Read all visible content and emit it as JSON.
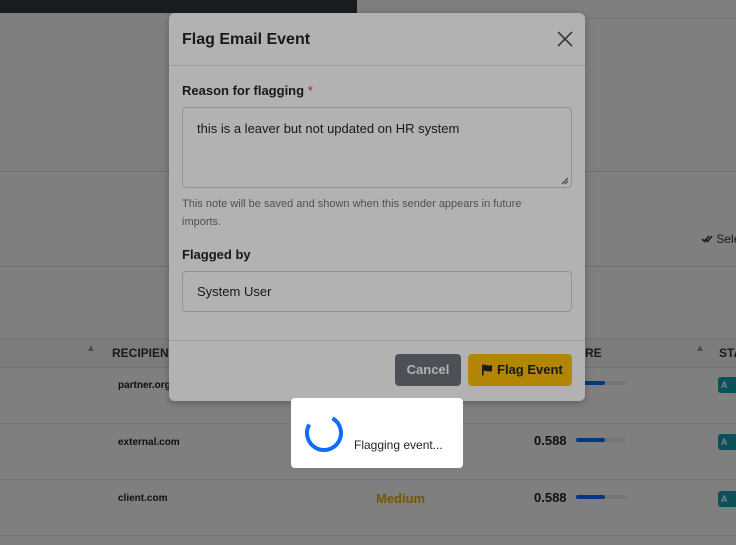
{
  "background": {
    "select_all_label": "Sele",
    "table": {
      "headers": {
        "recipient": "RECIPIENT",
        "score": "RE",
        "status": "STA"
      },
      "rows": [
        {
          "domain": "partner.org",
          "risk": "",
          "score": "",
          "score_fraction": 0.588,
          "status": "A"
        },
        {
          "domain": "external.com",
          "risk": "",
          "score": "0.588",
          "score_fraction": 0.588,
          "status": "A"
        },
        {
          "domain": "client.com",
          "risk": "Medium",
          "score": "0.588",
          "score_fraction": 0.588,
          "status": "A"
        }
      ]
    }
  },
  "modal": {
    "title": "Flag Email Event",
    "reason_label": "Reason for flagging",
    "required_mark": "*",
    "reason_value": "this is a leaver but not updated on HR system",
    "help_text": "This note will be saved and shown when this sender appears in future imports.",
    "flagged_by_label": "Flagged by",
    "flagged_by_value": "System User",
    "cancel_label": "Cancel",
    "flag_label": "Flag Event"
  },
  "loading": {
    "text": "Flagging event..."
  },
  "colors": {
    "primary": "#0d6efd",
    "warning": "#ffc107",
    "secondary": "#6c757d",
    "danger": "#dc3545",
    "info": "#17a2b8"
  },
  "icons": {
    "close": "close-icon",
    "flag": "flag-icon",
    "spinner": "spinner-icon",
    "sort": "sort-icon",
    "select_all": "check-double-icon"
  }
}
